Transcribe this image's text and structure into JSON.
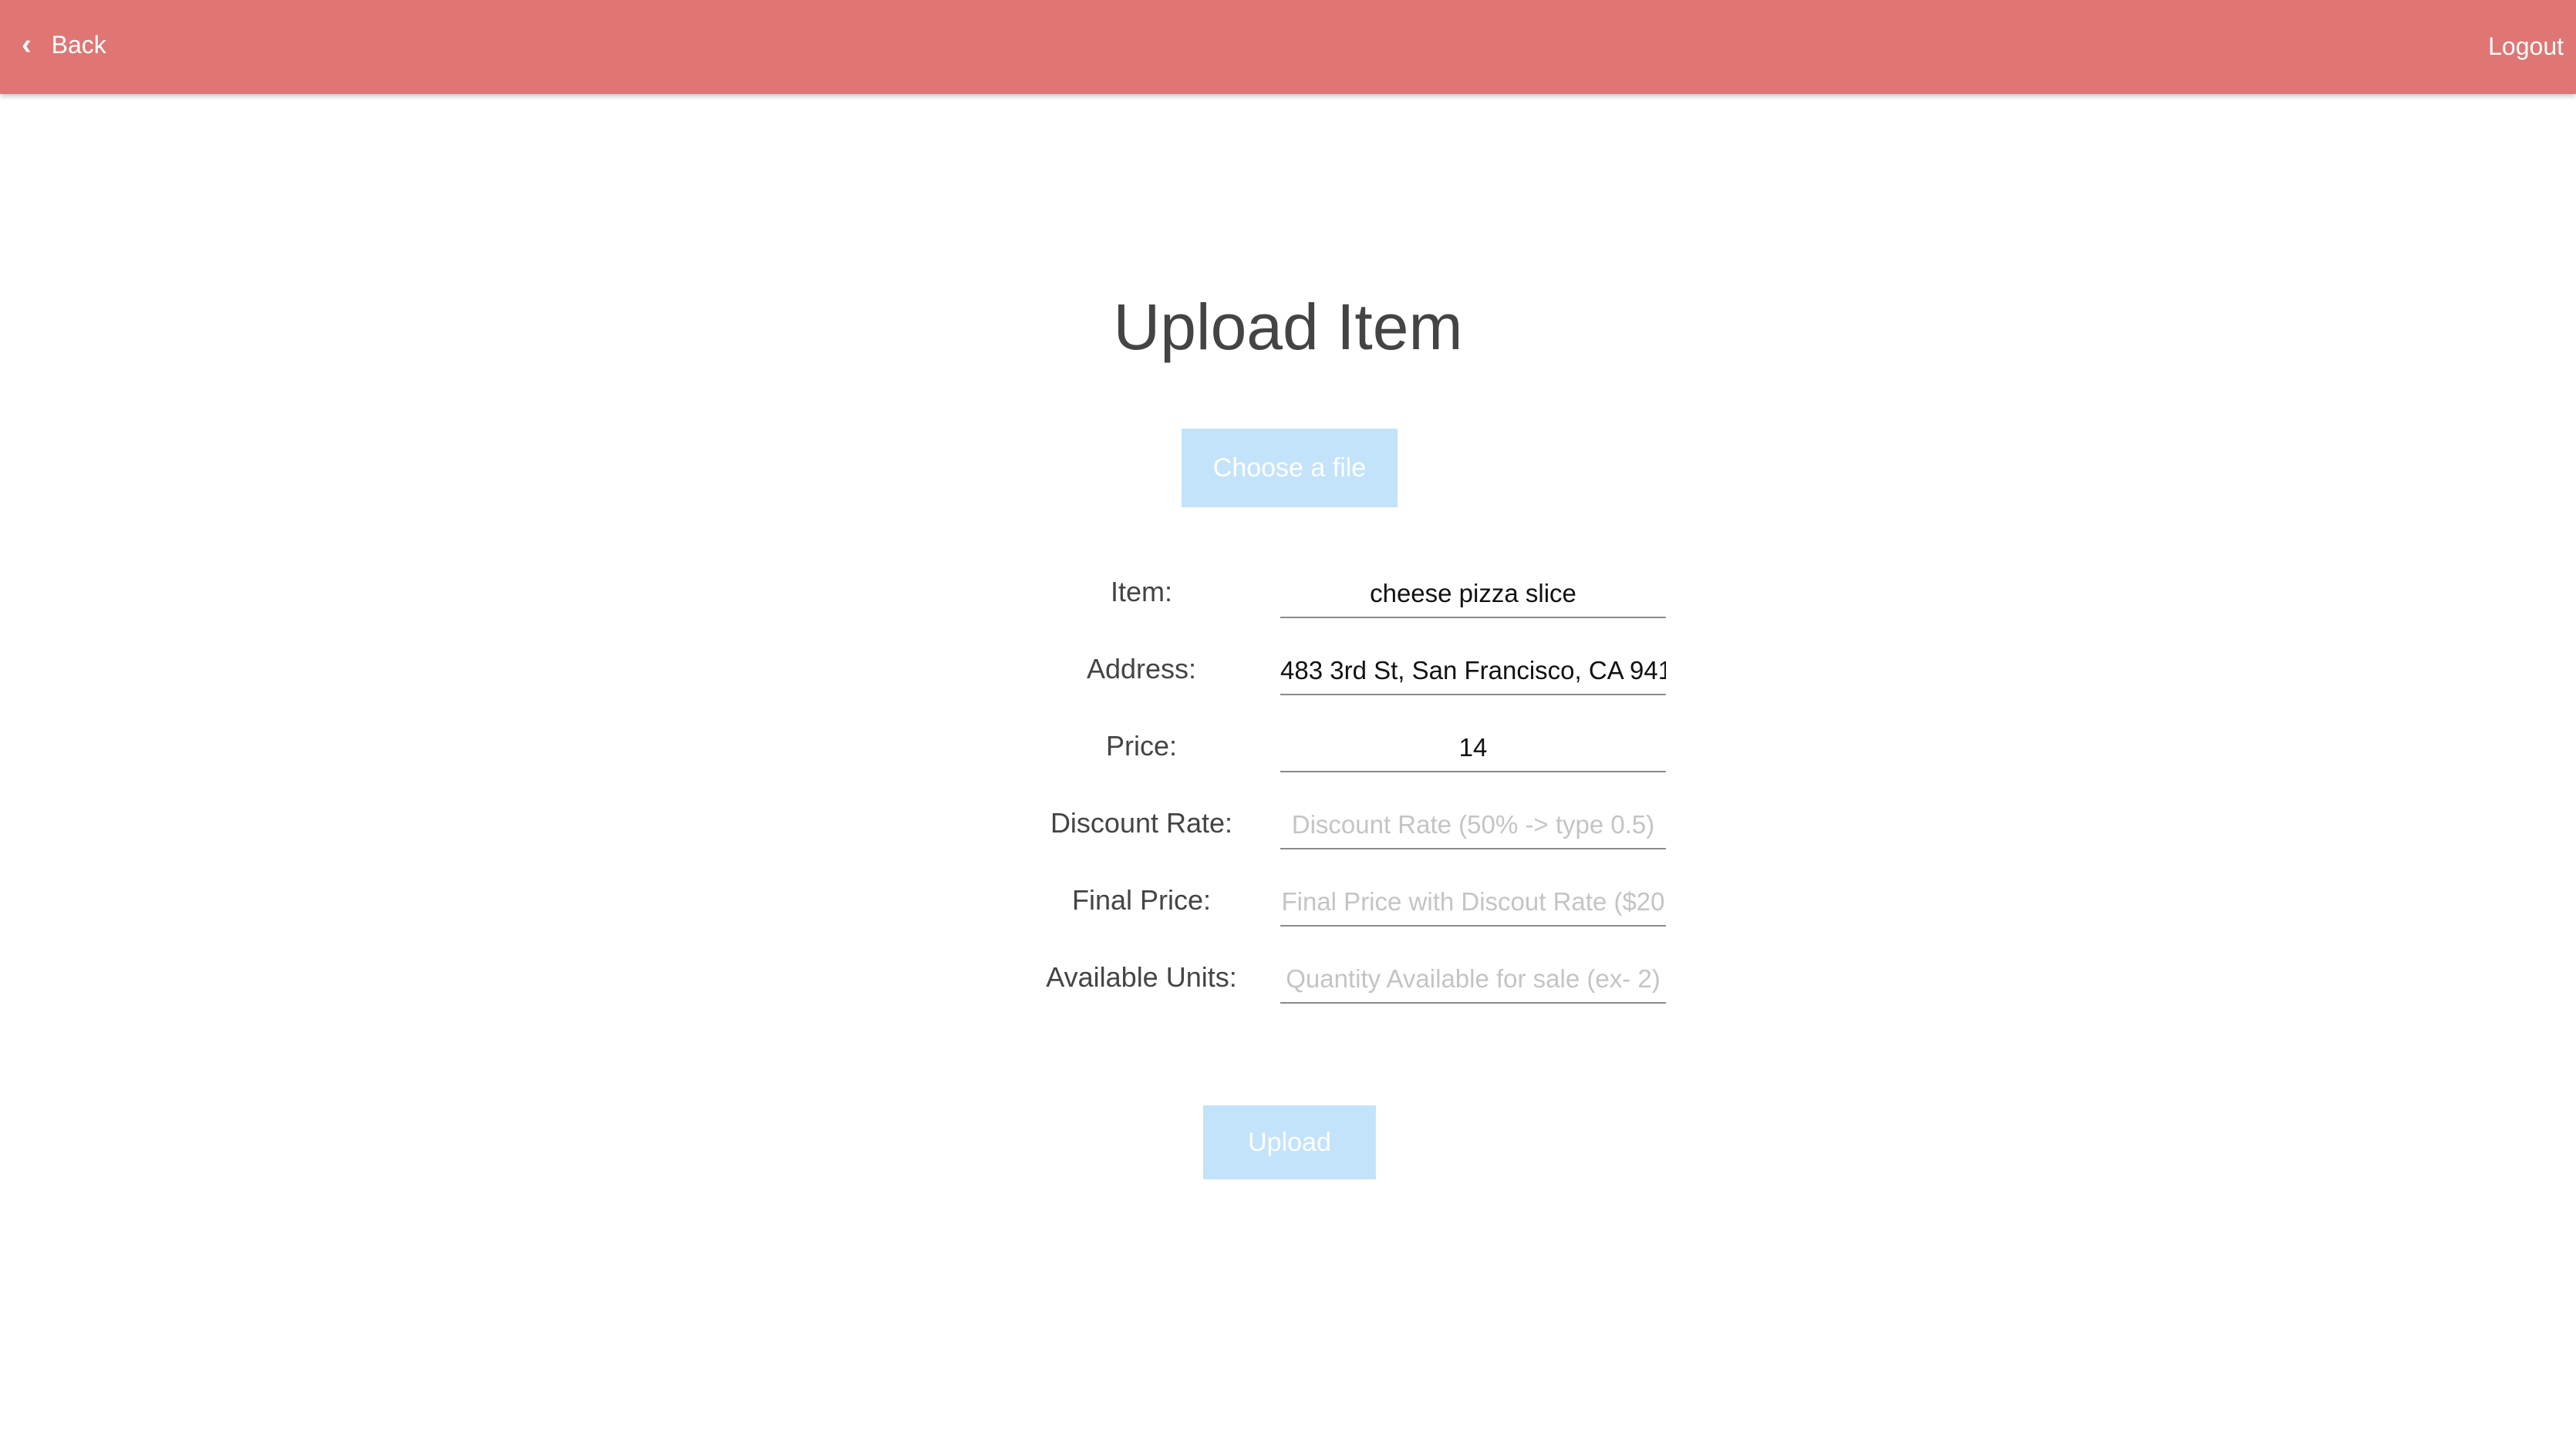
{
  "header": {
    "back_label": "Back",
    "back_icon": "chevron-left-icon",
    "logout_label": "Logout",
    "bar_color": "#df7674"
  },
  "main": {
    "title": "Upload Item",
    "choose_file_label": "Choose a file",
    "upload_label": "Upload",
    "button_color": "#c3e3fa"
  },
  "form": {
    "fields": [
      {
        "label": "Item:",
        "value": "cheese pizza slice",
        "placeholder": ""
      },
      {
        "label": "Address:",
        "value": "483 3rd St, San Francisco, CA 941",
        "placeholder": ""
      },
      {
        "label": "Price:",
        "value": "14",
        "placeholder": ""
      },
      {
        "label": "Discount Rate:",
        "value": "",
        "placeholder": "Discount Rate (50% -> type 0.5)"
      },
      {
        "label": "Final Price:",
        "value": "",
        "placeholder": "Final Price with Discout Rate ($20"
      },
      {
        "label": "Available Units:",
        "value": "",
        "placeholder": "Quantity Available for sale (ex- 2)"
      }
    ]
  }
}
